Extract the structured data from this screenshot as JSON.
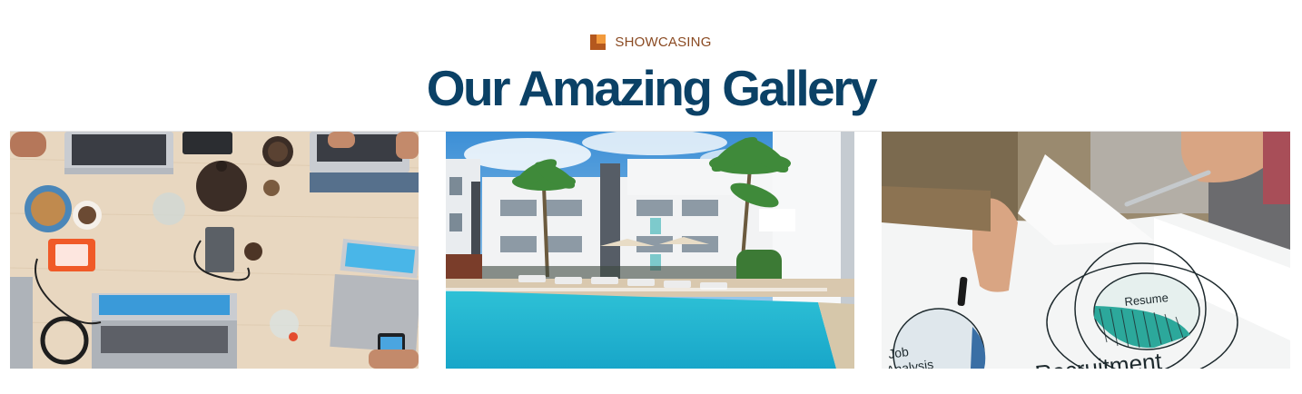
{
  "section": {
    "eyebrow": "SHOWCASING",
    "title": "Our Amazing Gallery"
  },
  "gallery": {
    "images": [
      {
        "subject": "workspace-desk",
        "alt": "Overhead view of laptops on a wooden desk"
      },
      {
        "subject": "hotel-pool",
        "alt": "Apartment building with palm trees and swimming pool"
      },
      {
        "subject": "recruitment-chart",
        "alt": "Hands pointing at a recruitment diagram"
      }
    ],
    "diagram_labels": {
      "resume": "Resume",
      "job_analysis_line1": "Job",
      "job_analysis_line2": "Analysis",
      "recruitment": "Recruitment"
    }
  },
  "colors": {
    "title": "#0b4166",
    "eyebrow_text": "#8a4a22",
    "eyebrow_icon_dark": "#b4581e",
    "eyebrow_icon_light": "#f29a3c"
  }
}
